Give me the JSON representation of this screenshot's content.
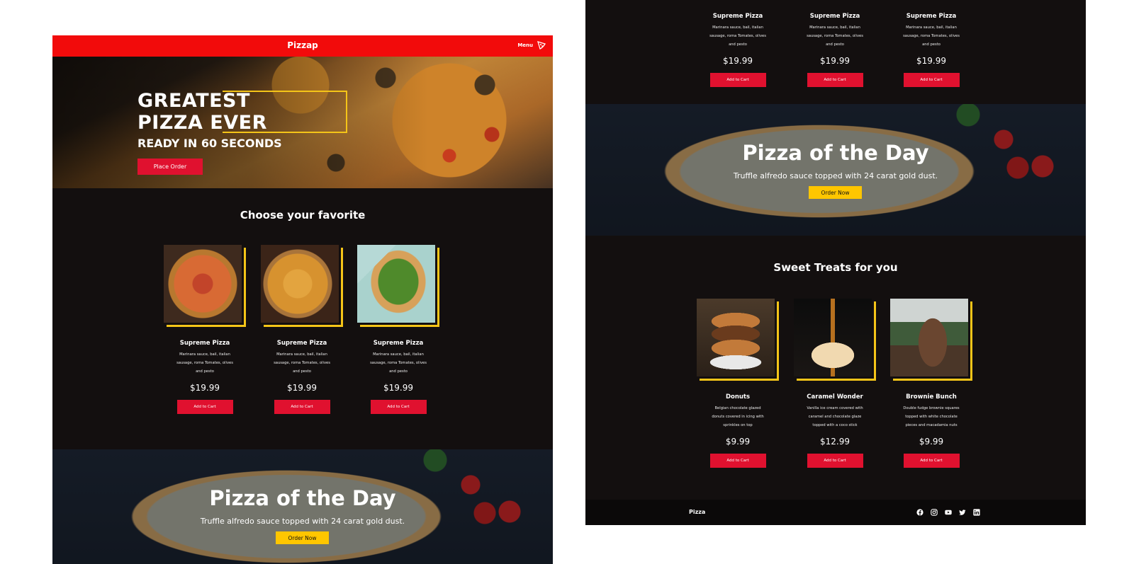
{
  "colors": {
    "brand_red": "#f20b0b",
    "button_red": "#e0112f",
    "accent_yellow": "#f5c518",
    "order_yellow": "#ffc600",
    "page_dark": "#130f0f"
  },
  "header": {
    "brand": "Pizzap",
    "menu_label": "Menu",
    "menu_icon": "pizza-slice-icon"
  },
  "hero": {
    "title_line1": "GREATEST",
    "title_line2": "PIZZA EVER",
    "subtitle": "READY IN 60 SECONDS",
    "button": "Place Order"
  },
  "favorites": {
    "title": "Choose your favorite",
    "items": [
      {
        "name": "Supreme Pizza",
        "desc": "Marinara sauce, bail, italian sausage, roma Tomates, olives and pesto",
        "price": "$19.99",
        "button": "Add to Cart"
      },
      {
        "name": "Supreme Pizza",
        "desc": "Marinara sauce, bail, italian sausage, roma Tomates, olives and pesto",
        "price": "$19.99",
        "button": "Add to Cart"
      },
      {
        "name": "Supreme Pizza",
        "desc": "Marinara sauce, bail, italian sausage, roma Tomates, olives and pesto",
        "price": "$19.99",
        "button": "Add to Cart"
      }
    ]
  },
  "pizza_of_day": {
    "title": "Pizza of the Day",
    "subtitle": "Truffle alfredo sauce topped with 24 carat gold dust.",
    "button": "Order Now"
  },
  "sweets": {
    "title": "Sweet Treats for you",
    "items": [
      {
        "name": "Donuts",
        "desc": "Belgian chocolate glazed donuts covered in icing with sprinkles on top",
        "price": "$9.99",
        "button": "Add to Cart"
      },
      {
        "name": "Caramel Wonder",
        "desc": "Vanilla ice cream covered with caramel and chocolate glaze topped with a coco stick",
        "price": "$12.99",
        "button": "Add to Cart"
      },
      {
        "name": "Brownie Bunch",
        "desc": "Double fudge brownie squares topped with white chocolate pieces and macadamia nuts",
        "price": "$9.99",
        "button": "Add to Cart"
      }
    ]
  },
  "footer": {
    "brand": "Pizza",
    "socials": [
      "facebook-icon",
      "instagram-icon",
      "youtube-icon",
      "twitter-icon",
      "linkedin-icon"
    ]
  }
}
